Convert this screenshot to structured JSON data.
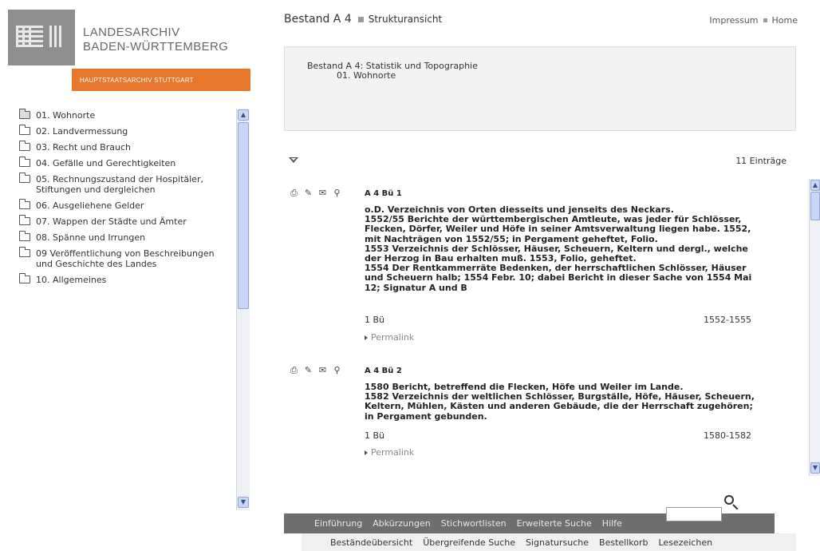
{
  "logo": {
    "line1": "LANDESARCHIV",
    "line2": "BADEN-WÜRTTEMBERG",
    "band": "HAUPTSTAATSARCHIV STUTTGART"
  },
  "sidebar": {
    "items": [
      {
        "label": "01. Wohnorte"
      },
      {
        "label": "02. Landvermessung"
      },
      {
        "label": "03. Recht und Brauch"
      },
      {
        "label": "04. Gefälle und Gerechtigkeiten"
      },
      {
        "label": "05. Rechnungszustand der Hospitäler, Stiftungen und dergleichen"
      },
      {
        "label": "06. Ausgeliehene Gelder"
      },
      {
        "label": "07. Wappen der Städte und Ämter"
      },
      {
        "label": "08. Spänne und Irrungen"
      },
      {
        "label": "09 Veröffentlichung von Beschreibungen und Geschichte des Landes"
      },
      {
        "label": "10. Allgemeines"
      }
    ]
  },
  "header": {
    "title": "Bestand A 4",
    "view": "Strukturansicht",
    "impressum": "Impressum",
    "home": "Home"
  },
  "breadcrumb": {
    "line1": "Bestand A 4: Statistik und Topographie",
    "line2": "01. Wohnorte"
  },
  "count": "11 Einträge",
  "entries": [
    {
      "signature": "A 4 Bü 1",
      "description": "o.D. Verzeichnis von Orten diesseits und jenseits des Neckars.\n1552/55 Berichte der württembergischen Amtleute, was jeder für Schlösser, Flecken, Dörfer, Weiler und Höfe in seiner Amtsverwaltung liegen habe. 1552, mit Nachträgen von 1552/55; in Pergament geheftet, Folio.\n1553 Verzeichnis der Schlösser, Häuser, Scheuern, Keltern und dergl., welche der Herzog in Bau erhalten muß. 1553, Folio, geheftet.\n1554 Der Rentkammerräte Bedenken, der herrschaftlichen Schlösser, Häuser und Scheuern halb; 1554 Febr. 10; dabei Bericht in dieser Sache von 1554 Mai 12; Signatur A und B",
      "extent": "1 Bü",
      "date": "1552-1555",
      "permalink": "Permalink"
    },
    {
      "signature": "A 4 Bü 2",
      "description": "1580 Bericht, betreffend die Flecken, Höfe und Weiler im Lande.\n1582 Verzeichnis der weltlichen Schlösser, Burgställe, Höfe, Häuser, Scheuern, Keltern, Mühlen, Kästen und anderen Gebäude, die der Herrschaft zugehören; in Pergament gebunden.",
      "extent": "1 Bü",
      "date": "1580-1582",
      "permalink": "Permalink"
    }
  ],
  "nav_primary": [
    "Einführung",
    "Abkürzungen",
    "Stichwortlisten",
    "Erweiterte Suche",
    "Hilfe"
  ],
  "nav_secondary": [
    "Beständeübersicht",
    "Übergreifende Suche",
    "Signatursuche",
    "Bestellkorb",
    "Lesezeichen"
  ],
  "colors": {
    "accent": "#e8772e",
    "nav_bg": "#6d6e70",
    "link": "#888888"
  }
}
